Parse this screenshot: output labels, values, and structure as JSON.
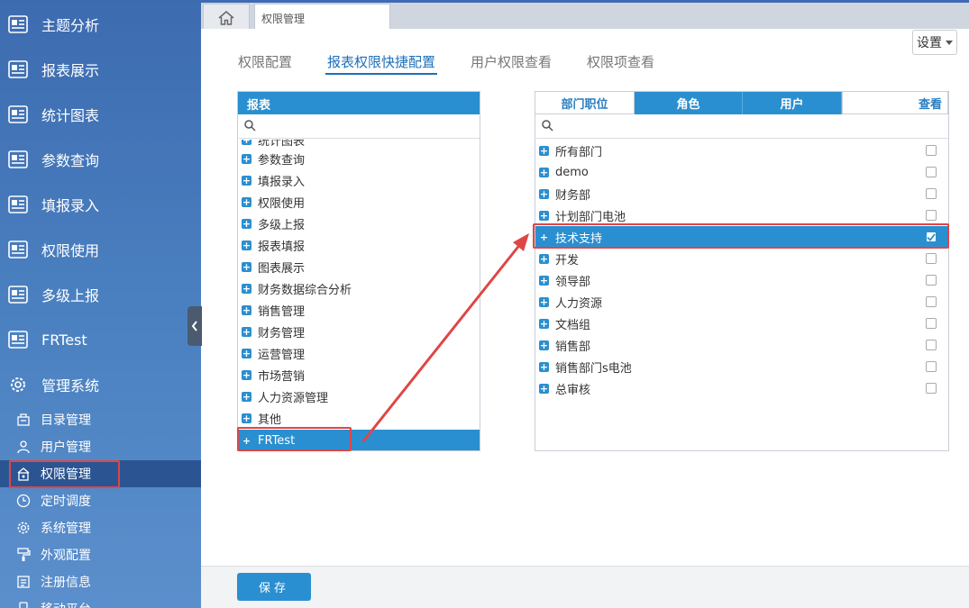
{
  "sidebar": {
    "items": [
      {
        "label": "主题分析",
        "icon": "report-icon"
      },
      {
        "label": "报表展示",
        "icon": "report-icon"
      },
      {
        "label": "统计图表",
        "icon": "report-icon"
      },
      {
        "label": "参数查询",
        "icon": "report-icon"
      },
      {
        "label": "填报录入",
        "icon": "report-icon"
      },
      {
        "label": "权限使用",
        "icon": "report-icon"
      },
      {
        "label": "多级上报",
        "icon": "report-icon"
      },
      {
        "label": "FRTest",
        "icon": "report-icon"
      },
      {
        "label": "管理系统",
        "icon": "gear-icon"
      }
    ],
    "sub_items": [
      {
        "label": "目录管理",
        "icon": "directory-icon"
      },
      {
        "label": "用户管理",
        "icon": "user-icon"
      },
      {
        "label": "权限管理",
        "icon": "lock-icon",
        "active": true
      },
      {
        "label": "定时调度",
        "icon": "clock-icon"
      },
      {
        "label": "系统管理",
        "icon": "gear-icon"
      },
      {
        "label": "外观配置",
        "icon": "paint-roller-icon"
      },
      {
        "label": "注册信息",
        "icon": "registration-icon"
      },
      {
        "label": "移动平台",
        "icon": "mobile-icon"
      }
    ]
  },
  "topbar": {
    "page_tab": "权限管理"
  },
  "settings_label": "设置",
  "main_tabs": [
    {
      "label": "权限配置",
      "active": false
    },
    {
      "label": "报表权限快捷配置",
      "active": true
    },
    {
      "label": "用户权限查看",
      "active": false
    },
    {
      "label": "权限项查看",
      "active": false
    }
  ],
  "report_panel": {
    "header": "报表",
    "search_placeholder": "",
    "partial_item": "统计图表",
    "items": [
      "参数查询",
      "填报录入",
      "权限使用",
      "多级上报",
      "报表填报",
      "图表展示",
      "财务数据综合分析",
      "销售管理",
      "财务管理",
      "运营管理",
      "市场营销",
      "人力资源管理",
      "其他"
    ],
    "selected_item": "FRTest"
  },
  "dept_panel": {
    "tabs": [
      {
        "label": "部门职位",
        "active": true
      },
      {
        "label": "角色",
        "active": false
      },
      {
        "label": "用户",
        "active": false
      },
      {
        "label": "查看",
        "active": true
      }
    ],
    "search_placeholder": "",
    "items": [
      {
        "label": "所有部门",
        "checked": false
      },
      {
        "label": "demo",
        "checked": false
      },
      {
        "label": "财务部",
        "checked": false
      },
      {
        "label": "计划部门电池",
        "checked": false
      },
      {
        "label": "技术支持",
        "checked": true,
        "selected": true
      },
      {
        "label": "开发",
        "checked": false
      },
      {
        "label": "领导部",
        "checked": false
      },
      {
        "label": "人力资源",
        "checked": false
      },
      {
        "label": "文档组",
        "checked": false
      },
      {
        "label": "销售部",
        "checked": false
      },
      {
        "label": "销售部门s电池",
        "checked": false
      },
      {
        "label": "总审核",
        "checked": false
      }
    ]
  },
  "save_label": "保存",
  "colors": {
    "accent": "#2a8fd0",
    "sidebar_active": "#2b5592",
    "highlight_red": "#e04545"
  }
}
